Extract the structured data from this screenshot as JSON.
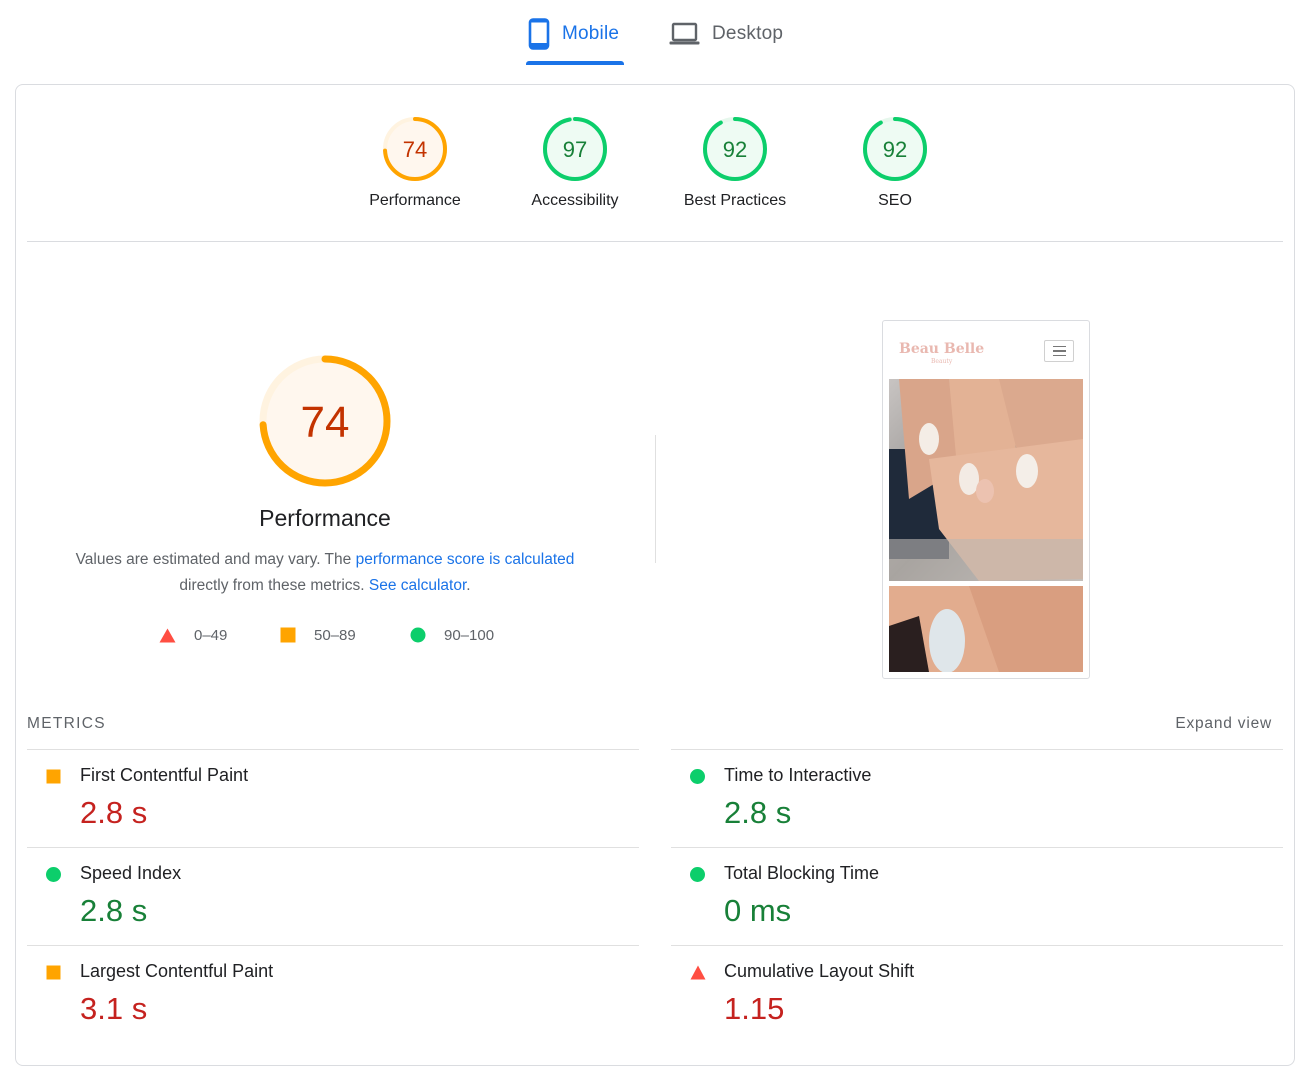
{
  "tabs": {
    "mobile_label": "Mobile",
    "desktop_label": "Desktop",
    "active": "Mobile"
  },
  "scores": [
    {
      "label": "Performance",
      "value": "74",
      "fraction": 0.74,
      "rating": "average"
    },
    {
      "label": "Accessibility",
      "value": "97",
      "fraction": 0.97,
      "rating": "pass"
    },
    {
      "label": "Best Practices",
      "value": "92",
      "fraction": 0.92,
      "rating": "pass"
    },
    {
      "label": "SEO",
      "value": "92",
      "fraction": 0.92,
      "rating": "pass"
    }
  ],
  "performance": {
    "score": "74",
    "title": "Performance",
    "desc_prefix": "Values are estimated and may vary. The ",
    "desc_link": "performance score is calculated",
    "desc_middle": "directly from these metrics. ",
    "desc_link2": "See calculator",
    "desc_suffix": "."
  },
  "legend": [
    {
      "shape": "triangle",
      "range": "0–49"
    },
    {
      "shape": "square",
      "range": "50–89"
    },
    {
      "shape": "circle",
      "range": "90–100"
    }
  ],
  "screenshot": {
    "brand": "Beau Belle",
    "brand_sub": "Beauty"
  },
  "metrics": {
    "heading": "METRICS",
    "expand_label": "Expand view",
    "items": [
      {
        "name": "First Contentful Paint",
        "value": "2.8 s",
        "rating": "average"
      },
      {
        "name": "Time to Interactive",
        "value": "2.8 s",
        "rating": "pass"
      },
      {
        "name": "Speed Index",
        "value": "2.8 s",
        "rating": "pass"
      },
      {
        "name": "Total Blocking Time",
        "value": "0 ms",
        "rating": "pass"
      },
      {
        "name": "Largest Contentful Paint",
        "value": "3.1 s",
        "rating": "average"
      },
      {
        "name": "Cumulative Layout Shift",
        "value": "1.15",
        "rating": "fail"
      }
    ]
  },
  "colors": {
    "pass": "#0cce6b",
    "pass_text": "#188038",
    "average": "#ffa400",
    "average_text": "#c33300",
    "fail": "#ff4e42",
    "fail_text": "#c5221f",
    "accent": "#1a73e8"
  }
}
